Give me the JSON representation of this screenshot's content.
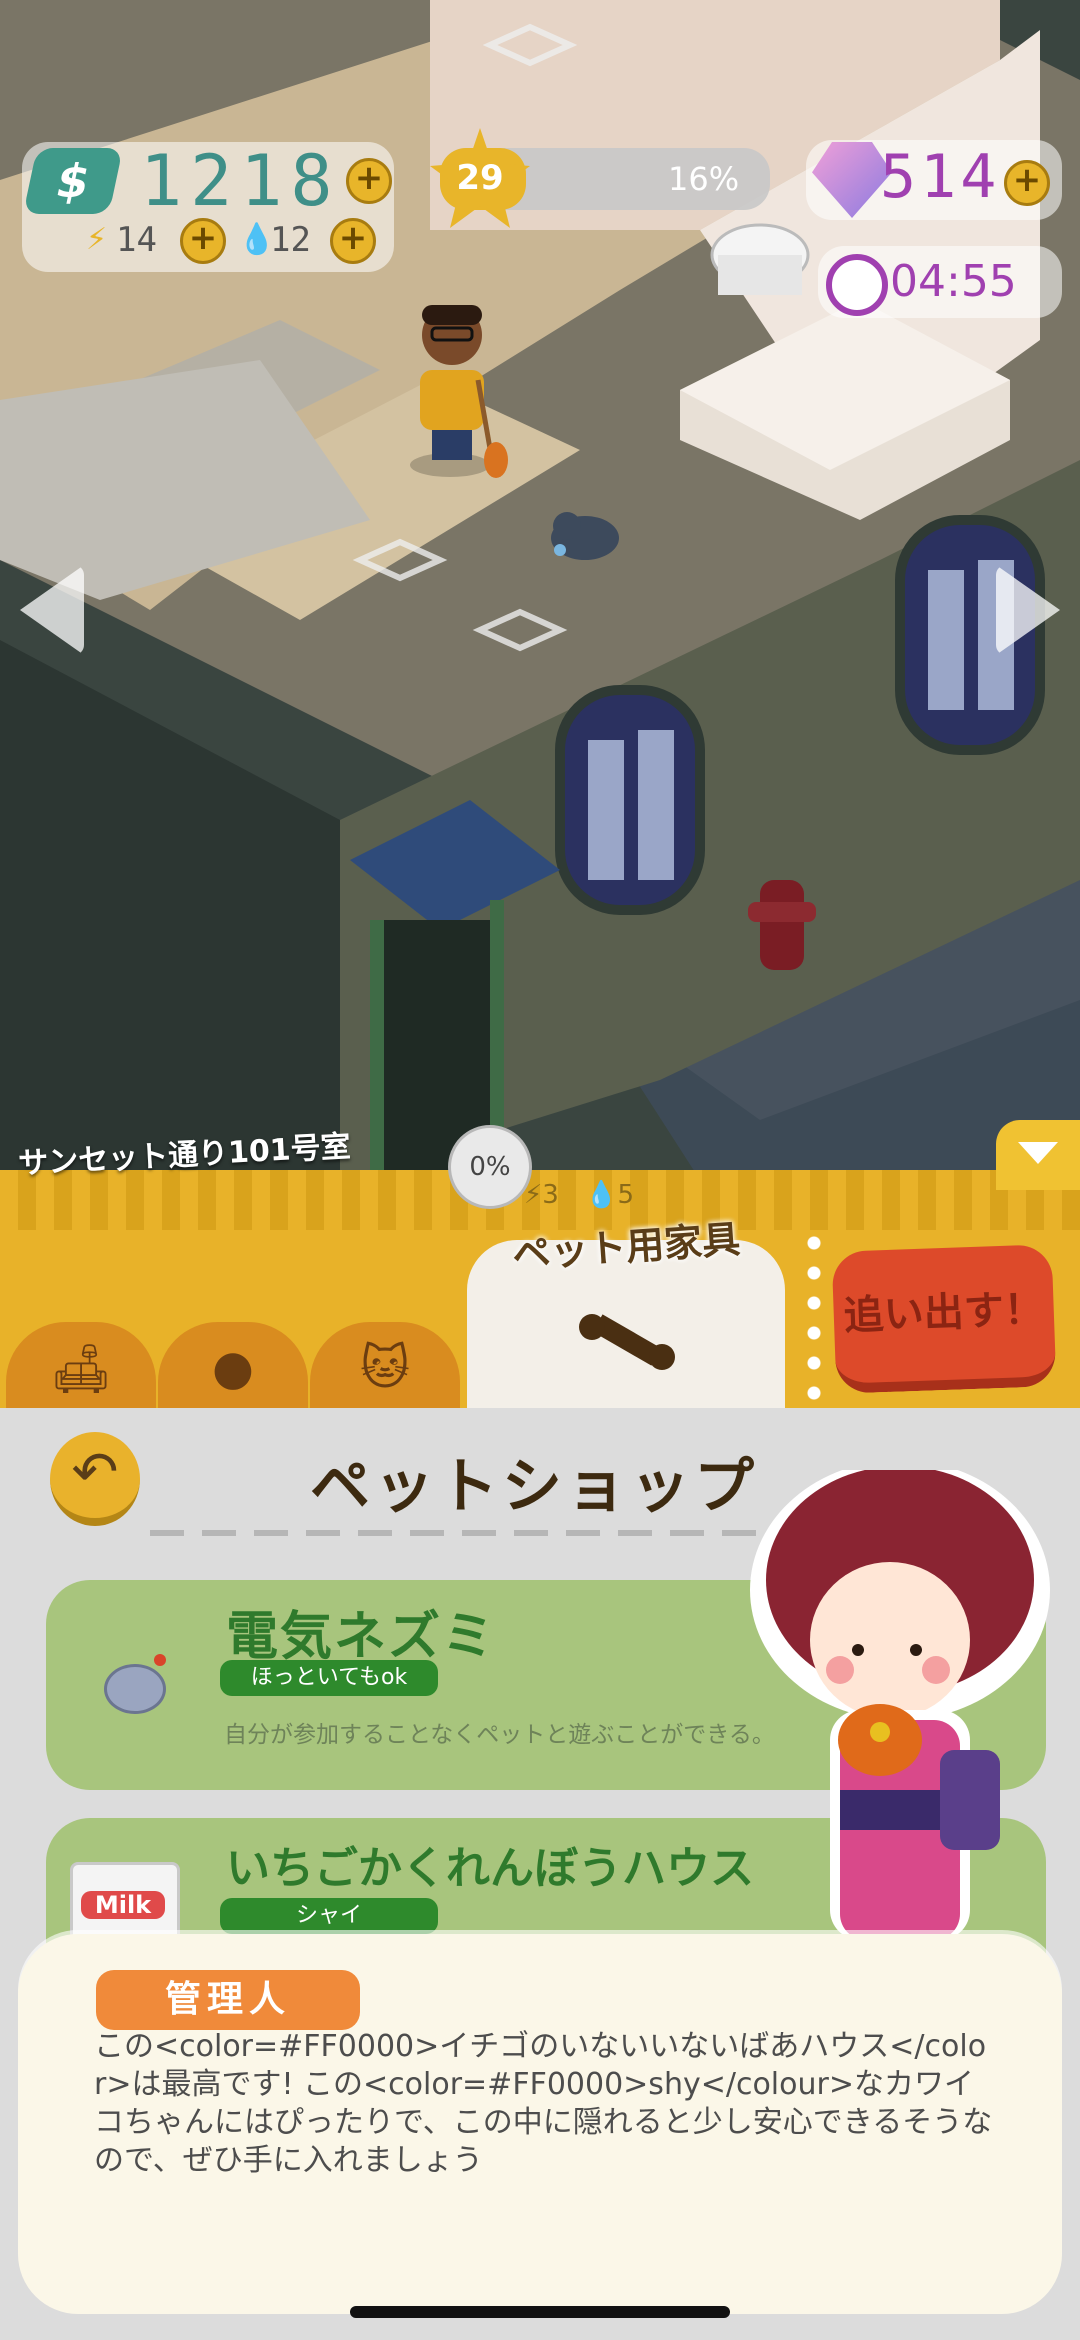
{
  "hud": {
    "cash": "1218",
    "energy": "14",
    "water": "12",
    "level": "29",
    "level_progress_text": "16%",
    "level_progress": 0.16,
    "gems": "514",
    "timer": "04:55"
  },
  "room": {
    "name": "サンセット通り101号室",
    "progress": "0%",
    "energy_cost": "3",
    "water_cost": "5"
  },
  "tabs": {
    "active_label": "ペット用家具",
    "evict_label": "追い出す！"
  },
  "shop": {
    "title": "ペットショップ",
    "items": [
      {
        "name": "電気ネズミ",
        "tag": "ほっといてもok",
        "description": "自分が参加することなくペットと遊ぶことができる。"
      },
      {
        "name": "いちごかくれんぼうハウス",
        "tag": "シャイ",
        "milk_label": "Milk"
      }
    ]
  },
  "dialogue": {
    "speaker": "管理人",
    "text": "この<color=#FF0000>イチゴのいないいないばあハウス</color>は最高です! この<color=#FF0000>shy</colour>なカワイコちゃんにはぴったりで、この中に隠れると少し安心できるそうなので、ぜひ手に入れましょう"
  },
  "colors": {
    "accent_yellow": "#e8b229",
    "card_green": "#a8c57d",
    "tag_green": "#2e8a2c",
    "evict_red": "#dd4a2a",
    "speaker_orange": "#f08a3a"
  }
}
